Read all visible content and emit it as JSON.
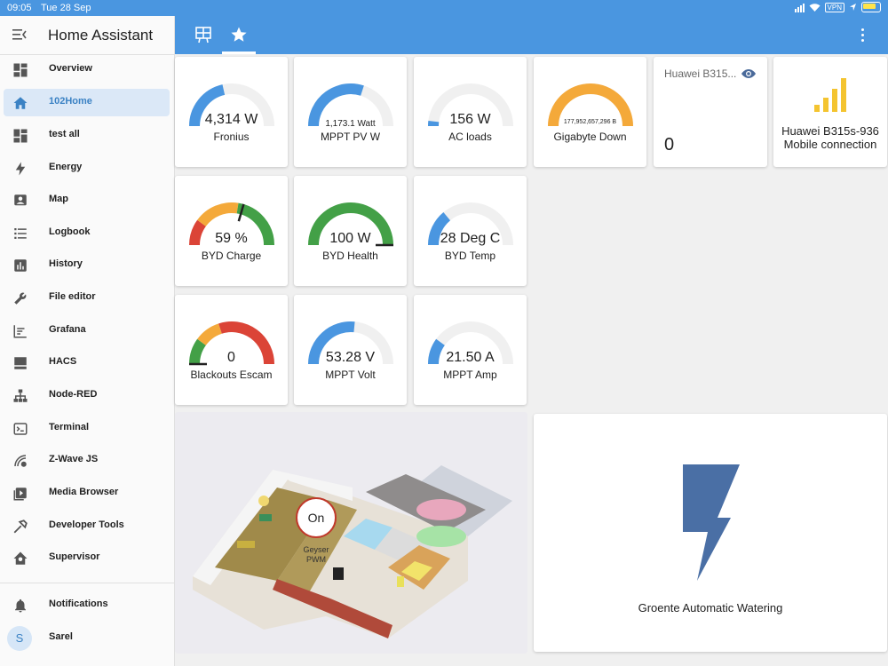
{
  "statusbar": {
    "time": "09:05",
    "date": "Tue 28 Sep",
    "vpn": "VPN"
  },
  "sidebar": {
    "title": "Home Assistant",
    "items": [
      {
        "label": "Overview",
        "icon": "dashboard-icon"
      },
      {
        "label": "102Home",
        "icon": "home-icon",
        "active": true
      },
      {
        "label": "test all",
        "icon": "dashboard-icon"
      },
      {
        "label": "Energy",
        "icon": "lightning-icon"
      },
      {
        "label": "Map",
        "icon": "map-marker-icon"
      },
      {
        "label": "Logbook",
        "icon": "list-icon"
      },
      {
        "label": "History",
        "icon": "chart-bar-icon"
      },
      {
        "label": "File editor",
        "icon": "wrench-icon"
      },
      {
        "label": "Grafana",
        "icon": "chart-line-icon"
      },
      {
        "label": "HACS",
        "icon": "hacs-icon"
      },
      {
        "label": "Node-RED",
        "icon": "sitemap-icon"
      },
      {
        "label": "Terminal",
        "icon": "terminal-icon"
      },
      {
        "label": "Z-Wave JS",
        "icon": "zwave-icon"
      },
      {
        "label": "Media Browser",
        "icon": "play-box-icon"
      },
      {
        "label": "Developer Tools",
        "icon": "hammer-icon"
      },
      {
        "label": "Supervisor",
        "icon": "home-assistant-icon"
      }
    ],
    "notifications": "Notifications",
    "user": {
      "name": "Sarel",
      "initial": "S"
    }
  },
  "gauges": [
    {
      "name": "Fronius",
      "value": "4,314 W",
      "fraction": 0.43,
      "color": "#4a96e0"
    },
    {
      "name": "MPPT PV W",
      "value": "1,173.1 Watt",
      "fraction": 0.6,
      "color": "#4a96e0"
    },
    {
      "name": "AC loads",
      "value": "156 W",
      "fraction": 0.04,
      "color": "#4a96e0"
    },
    {
      "name": "Gigabyte Down",
      "value": "177,952,657,296 B",
      "fraction": 1.0,
      "color": "#f4a93a"
    },
    {
      "name": "BYD Charge",
      "value": "59 %",
      "fraction": 0.59,
      "segments": true,
      "needle": true
    },
    {
      "name": "BYD Health",
      "value": "100 W",
      "fraction": 1.0,
      "color": "#43a047",
      "needle": true
    },
    {
      "name": "BYD Temp",
      "value": "28 Deg C",
      "fraction": 0.28,
      "color": "#4a96e0"
    },
    {
      "name": "Blackouts Escam",
      "value": "0",
      "fraction": 0.0,
      "segments": true,
      "needle": true
    },
    {
      "name": "MPPT Volt",
      "value": "53.28 V",
      "fraction": 0.53,
      "color": "#4a96e0"
    },
    {
      "name": "MPPT Amp",
      "value": "21.50 A",
      "fraction": 0.2,
      "color": "#4a96e0"
    }
  ],
  "huawei_sensor": {
    "name": "Huawei B315...",
    "value": "0"
  },
  "huawei_signal": {
    "line1": "Huawei B315s-936",
    "line2": "Mobile connection",
    "color": "#f4c430"
  },
  "floorplan": {
    "geyser_state": "On",
    "geyser_label": "Geyser PWM"
  },
  "watering": {
    "name": "Groente Automatic Watering",
    "color": "#4a6fa5"
  },
  "colors": {
    "accent": "#4a96e0",
    "track": "#f0f0f0",
    "green": "#43a047",
    "orange": "#f4a93a",
    "red": "#db4437"
  }
}
